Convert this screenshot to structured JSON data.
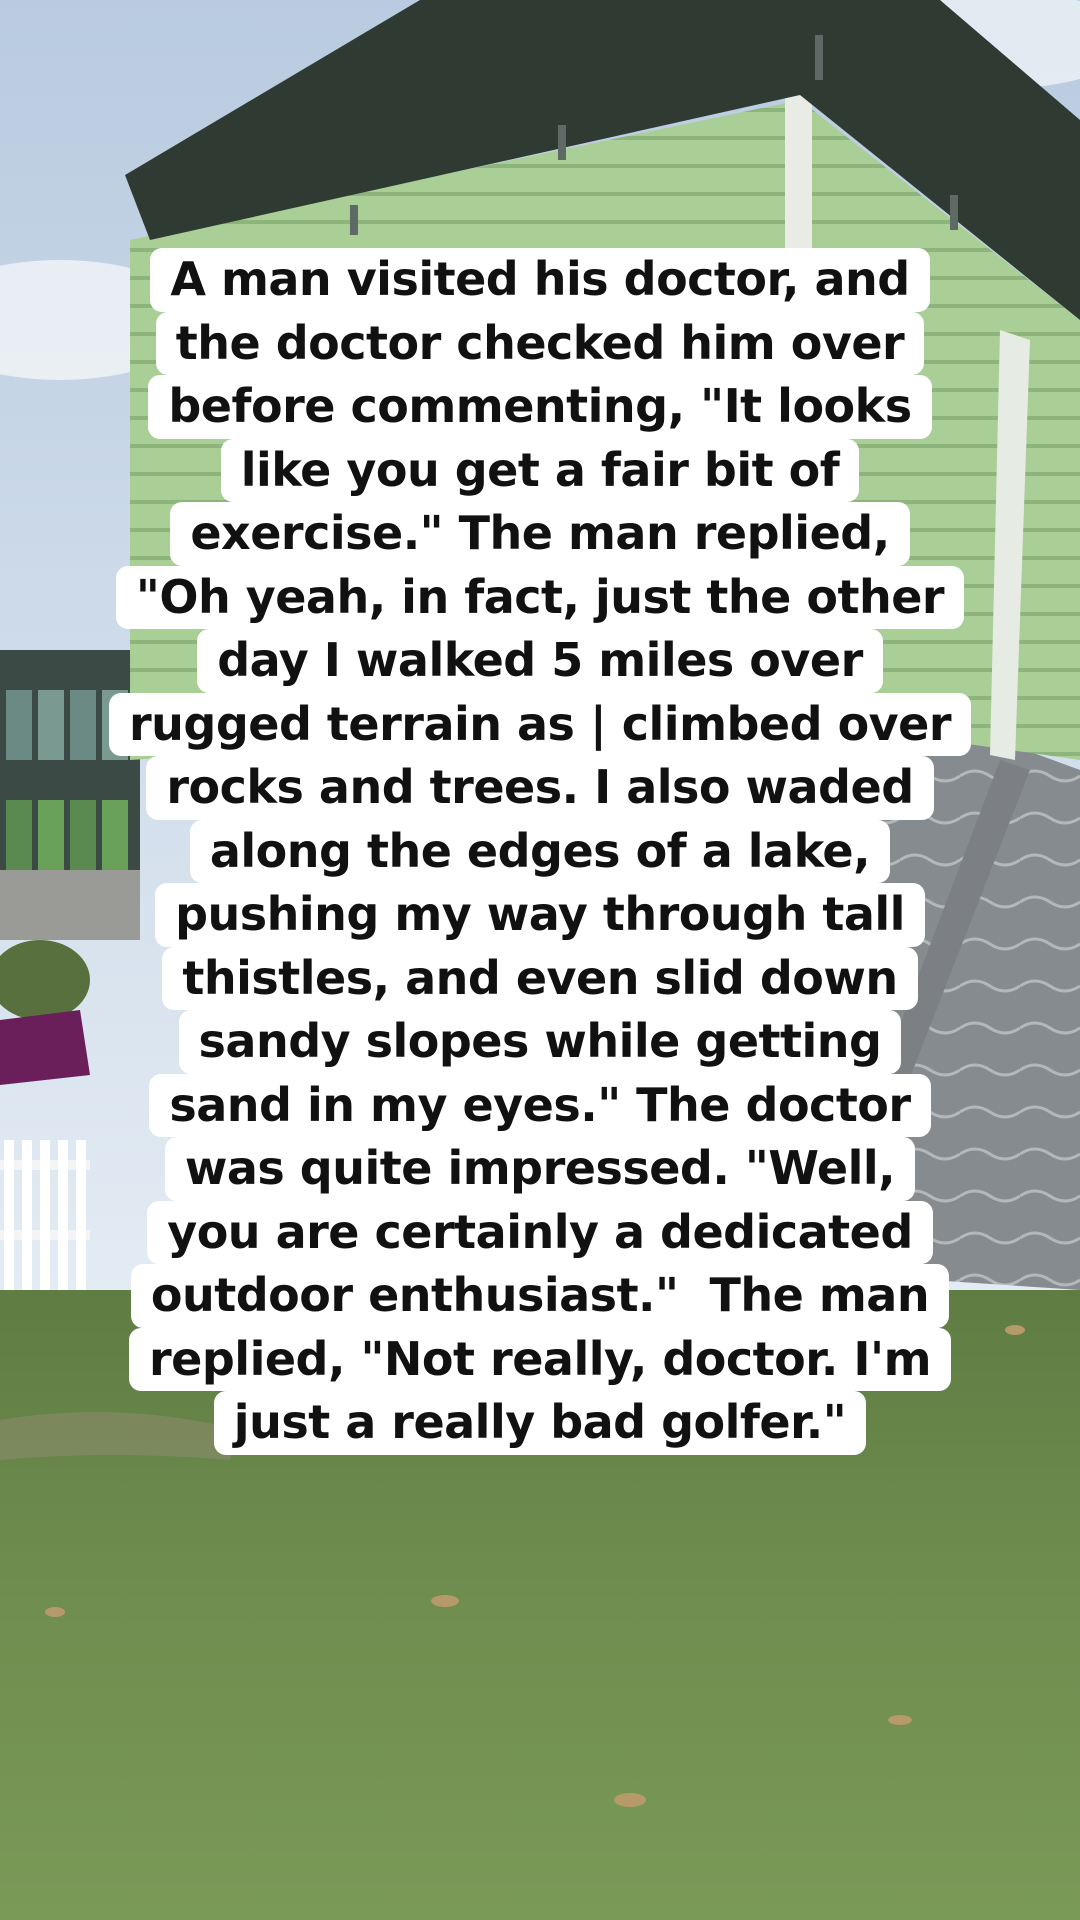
{
  "caption": {
    "lines": [
      "A man visited his doctor, and",
      "the doctor checked him over",
      "before commenting, \"It looks",
      "like you get a fair bit of",
      "exercise.\" The man replied,",
      "\"Oh yeah, in fact, just the other",
      "day I walked 5 miles over",
      "rugged terrain as | climbed over",
      "rocks and trees. I also waded",
      "along the edges of a lake,",
      "pushing my way through tall",
      "thistles, and even slid down",
      "sandy slopes while getting",
      "sand in my eyes.\" The doctor",
      "was quite impressed. \"Well,",
      "you are certainly a dedicated",
      "outdoor enthusiast.\"  The man",
      "replied, \"Not really, doctor. I'm",
      "just a really bad golfer.\""
    ]
  },
  "scene": {
    "sky_color": "#cfdcea",
    "siding_color": "#a9cf96",
    "roof_color": "#2f3a33",
    "metal_color": "#8b8f93",
    "grass_color": "#6f8e4f",
    "canopy_color": "#6a1f5a"
  }
}
